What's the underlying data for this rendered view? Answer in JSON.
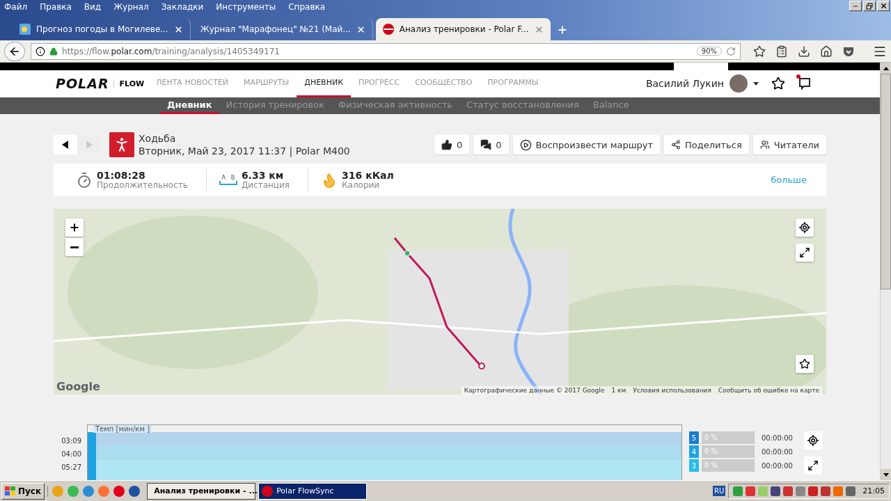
{
  "menu_bar": [
    "Файл",
    "Правка",
    "Вид",
    "Журнал",
    "Закладки",
    "Инструменты",
    "Справка"
  ],
  "tabs": [
    {
      "title": "Прогноз погоды в Могилеве...",
      "selected": false,
      "kind": "weather"
    },
    {
      "title": "Журнал \"Марафонец\" №21 (Май...",
      "selected": false,
      "kind": "plain"
    },
    {
      "title": "Анализ тренировки - Polar F...",
      "selected": true,
      "kind": "polar"
    }
  ],
  "address_bar": {
    "url_prefix": "https://flow.",
    "url_host": "polar.com",
    "url_path": "/training/analysis/1405349171",
    "zoom": "90%"
  },
  "site_header": {
    "logo": "POLAR",
    "product": "FLOW",
    "nav": [
      {
        "label": "ЛЕНТА НОВОСТЕЙ",
        "selected": false
      },
      {
        "label": "МАРШРУТЫ",
        "selected": false
      },
      {
        "label": "ДНЕВНИК",
        "selected": true
      },
      {
        "label": "ПРОГРЕСС",
        "selected": false
      },
      {
        "label": "СООБЩЕСТВО",
        "selected": false
      },
      {
        "label": "ПРОГРАММЫ",
        "selected": false
      }
    ],
    "user_name": "Василий Лукин",
    "has_notification": true
  },
  "sub_nav": [
    {
      "label": "Дневник",
      "selected": true
    },
    {
      "label": "История тренировок",
      "selected": false
    },
    {
      "label": "Физическая активность",
      "selected": false
    },
    {
      "label": "Статус восстановления",
      "selected": false
    },
    {
      "label": "Balance",
      "selected": false
    }
  ],
  "activity": {
    "sport": "Ходьба",
    "details": "Вторник, Май 23, 2017 11:37 | Polar M400",
    "actions": [
      {
        "kind": "like",
        "label": "0"
      },
      {
        "kind": "comment",
        "label": "0"
      },
      {
        "kind": "replay",
        "label": "Воспроизвести маршрут"
      },
      {
        "kind": "share",
        "label": "Поделиться"
      },
      {
        "kind": "followers",
        "label": "Читатели"
      }
    ]
  },
  "summary": {
    "stats": [
      {
        "kind": "duration",
        "value": "01:08:28",
        "label": "Продолжительность"
      },
      {
        "kind": "distance",
        "value": "6.33 км",
        "label": "Дистанция",
        "marks": [
          "A",
          "B"
        ]
      },
      {
        "kind": "calories",
        "value": "316 кКал",
        "label": "Калории"
      }
    ],
    "more": "больше"
  },
  "map": {
    "logo": "Google",
    "attribution": "Картографические данные © 2017 Google",
    "scale": "1 км",
    "terms": "Условия использования",
    "report": "Сообщить об ошибке на карте"
  },
  "pace_chart": {
    "title": "Темп [мин/км ]",
    "y_labels": [
      "03:09",
      "04:00",
      "05:27"
    ],
    "zones": [
      {
        "zone": "5",
        "color": "#1a7dcc",
        "share": "0 %",
        "time": "00:00:00"
      },
      {
        "zone": "4",
        "color": "#1fa3e0",
        "share": "0 %",
        "time": "00:00:00"
      },
      {
        "zone": "3",
        "color": "#24bde9",
        "share": "0 %",
        "time": "00:00:00"
      }
    ]
  },
  "taskbar": {
    "start": "Пуск",
    "tasks": [
      {
        "title": "Анализ тренировки - ...",
        "selected": true,
        "kind": "firefox"
      },
      {
        "title": "Polar FlowSync",
        "selected": false,
        "kind": "flowsync"
      }
    ],
    "language": "RU",
    "clock": "21:05"
  }
}
